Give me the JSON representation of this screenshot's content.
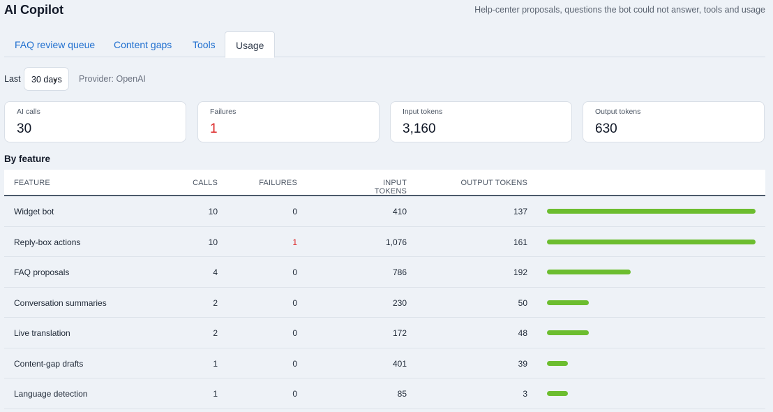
{
  "app": {
    "title": "AI Copilot",
    "subtitle": "Help-center proposals, questions the bot could not answer, tools and usage"
  },
  "tabs": [
    {
      "label": "FAQ review queue",
      "active": false
    },
    {
      "label": "Content gaps",
      "active": false
    },
    {
      "label": "Tools",
      "active": false
    },
    {
      "label": "Usage",
      "active": true
    }
  ],
  "filter": {
    "label": "Last",
    "range": "30 days",
    "provider": "Provider: OpenAI"
  },
  "stats": [
    {
      "label": "AI calls",
      "value": "30"
    },
    {
      "label": "Failures",
      "value": "1",
      "danger": true
    },
    {
      "label": "Input tokens",
      "value": "3,160"
    },
    {
      "label": "Output tokens",
      "value": "630"
    }
  ],
  "by_feature": {
    "title": "By feature",
    "columns": [
      "FEATURE",
      "CALLS",
      "FAILURES",
      "INPUT TOKENS",
      "OUTPUT TOKENS"
    ],
    "rows": [
      {
        "feature": "Widget bot",
        "calls": "10",
        "failures": "0",
        "input": "410",
        "output": "137",
        "calls_fraction": 1.0
      },
      {
        "feature": "Reply-box actions",
        "calls": "10",
        "failures": "1",
        "input": "1,076",
        "output": "161",
        "calls_fraction": 1.0
      },
      {
        "feature": "FAQ proposals",
        "calls": "4",
        "failures": "0",
        "input": "786",
        "output": "192",
        "calls_fraction": 0.4
      },
      {
        "feature": "Conversation summaries",
        "calls": "2",
        "failures": "0",
        "input": "230",
        "output": "50",
        "calls_fraction": 0.2
      },
      {
        "feature": "Live translation",
        "calls": "2",
        "failures": "0",
        "input": "172",
        "output": "48",
        "calls_fraction": 0.2
      },
      {
        "feature": "Content-gap drafts",
        "calls": "1",
        "failures": "0",
        "input": "401",
        "output": "39",
        "calls_fraction": 0.1
      },
      {
        "feature": "Language detection",
        "calls": "1",
        "failures": "0",
        "input": "85",
        "output": "3",
        "calls_fraction": 0.1
      }
    ]
  },
  "colors": {
    "bar": "#6cbd2f",
    "danger": "#dc2626",
    "link": "#1f6fcf"
  }
}
